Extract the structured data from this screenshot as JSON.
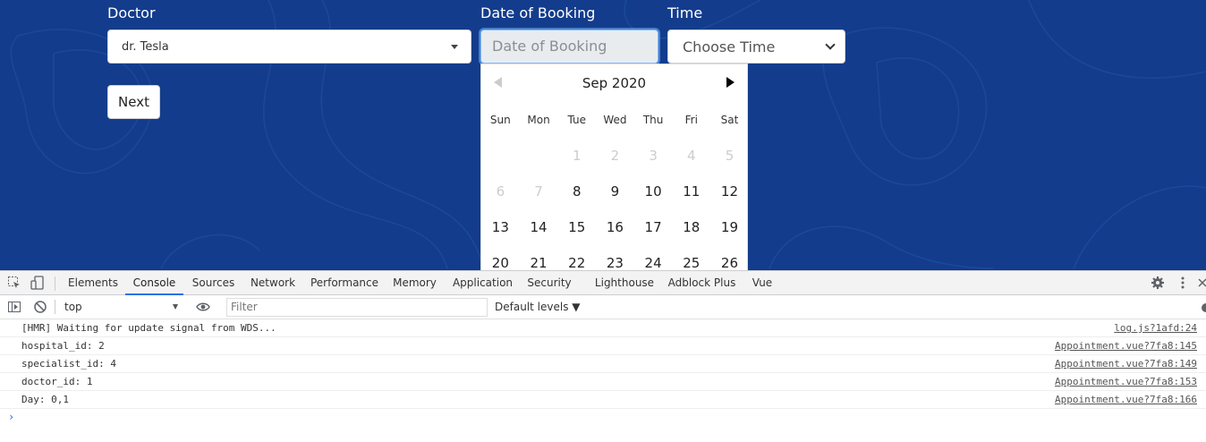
{
  "form": {
    "doctor_label": "Doctor",
    "doctor_value": "dr. Tesla",
    "date_label": "Date of Booking",
    "date_placeholder": "Date of Booking",
    "time_label": "Time",
    "time_value": "Choose Time",
    "next_label": "Next"
  },
  "calendar": {
    "title": "Sep 2020",
    "weekdays": [
      "Sun",
      "Mon",
      "Tue",
      "Wed",
      "Thu",
      "Fri",
      "Sat"
    ],
    "rows": [
      [
        {
          "d": "",
          "dis": true
        },
        {
          "d": "",
          "dis": true
        },
        {
          "d": "1",
          "dis": true
        },
        {
          "d": "2",
          "dis": true
        },
        {
          "d": "3",
          "dis": true
        },
        {
          "d": "4",
          "dis": true
        },
        {
          "d": "5",
          "dis": true
        }
      ],
      [
        {
          "d": "6",
          "dis": true
        },
        {
          "d": "7",
          "dis": true
        },
        {
          "d": "8",
          "dis": false
        },
        {
          "d": "9",
          "dis": false
        },
        {
          "d": "10",
          "dis": false
        },
        {
          "d": "11",
          "dis": false
        },
        {
          "d": "12",
          "dis": false
        }
      ],
      [
        {
          "d": "13",
          "dis": false
        },
        {
          "d": "14",
          "dis": false
        },
        {
          "d": "15",
          "dis": false
        },
        {
          "d": "16",
          "dis": false
        },
        {
          "d": "17",
          "dis": false
        },
        {
          "d": "18",
          "dis": false
        },
        {
          "d": "19",
          "dis": false
        }
      ],
      [
        {
          "d": "20",
          "dis": false
        },
        {
          "d": "21",
          "dis": false
        },
        {
          "d": "22",
          "dis": false
        },
        {
          "d": "23",
          "dis": false
        },
        {
          "d": "24",
          "dis": false
        },
        {
          "d": "25",
          "dis": false
        },
        {
          "d": "26",
          "dis": false
        }
      ]
    ]
  },
  "devtools": {
    "tabs": [
      "Elements",
      "Console",
      "Sources",
      "Network",
      "Performance",
      "Memory",
      "Application",
      "Security",
      "Lighthouse",
      "Adblock Plus",
      "Vue"
    ],
    "active_tab": "Console",
    "context": "top",
    "filter_placeholder": "Filter",
    "levels": "Default levels ▼",
    "logs": [
      {
        "msg": "[HMR] Waiting for update signal from WDS...",
        "src": "log.js?1afd:24"
      },
      {
        "msg": "hospital_id: 2",
        "src": "Appointment.vue?7fa8:145"
      },
      {
        "msg": "specialist_id: 4",
        "src": "Appointment.vue?7fa8:149"
      },
      {
        "msg": "doctor_id: 1",
        "src": "Appointment.vue?7fa8:153"
      },
      {
        "msg": "Day: 0,1",
        "src": "Appointment.vue?7fa8:166"
      }
    ],
    "prompt": "›"
  },
  "colors": {
    "background": "#133c8c",
    "accent": "#1a73e8"
  }
}
